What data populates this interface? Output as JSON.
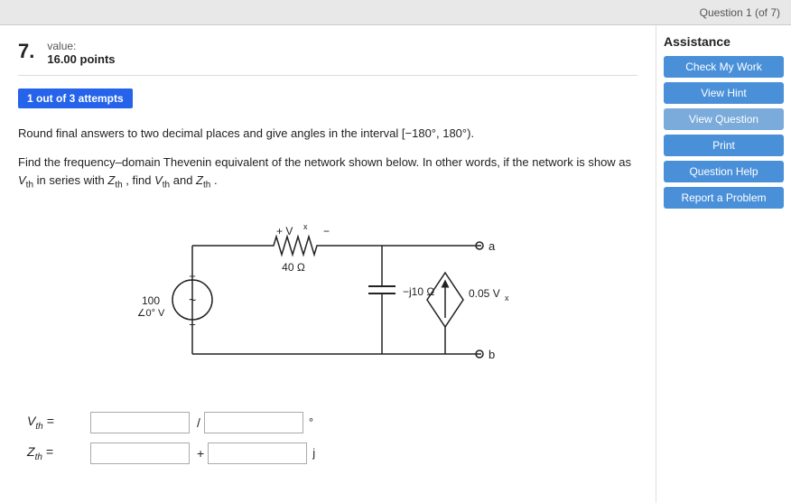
{
  "topbar": {
    "nav_label": "Question 1 (of 7)"
  },
  "question": {
    "number": "7.",
    "value_label": "value:",
    "value": "16.00 points"
  },
  "attempts": {
    "badge": "1 out of 3 attempts"
  },
  "instruction": {
    "text": "Round final answers to two decimal places and give angles in the interval [−180°, 180°)."
  },
  "problem": {
    "text": "Find the frequency–domain Thevenin equivalent of the network shown below. In other words, if the network is show as V th in series with Z th , find V th and Z th ."
  },
  "circuit": {
    "resistor_label": "40 Ω",
    "capacitor_label": "−j10 Ω",
    "source_label": "100∠0° V",
    "dependent_label": "0.05 V x",
    "vx_label": "+ V x −",
    "terminal_a": "a",
    "terminal_b": "b"
  },
  "answers": {
    "vth_label": "V th  =",
    "vth_placeholder1": "",
    "vth_sep": "/",
    "vth_unit": "°",
    "zth_label": "Z th  =",
    "zth_placeholder1": "",
    "zth_sep": "+",
    "zth_unit": "j"
  },
  "sidebar": {
    "title": "Assistance",
    "buttons": [
      {
        "label": "Check My Work",
        "type": "primary"
      },
      {
        "label": "View Hint",
        "type": "primary"
      },
      {
        "label": "View Question",
        "type": "secondary"
      },
      {
        "label": "Print",
        "type": "primary"
      },
      {
        "label": "Question Help",
        "type": "primary"
      },
      {
        "label": "Report a Problem",
        "type": "primary"
      }
    ]
  }
}
